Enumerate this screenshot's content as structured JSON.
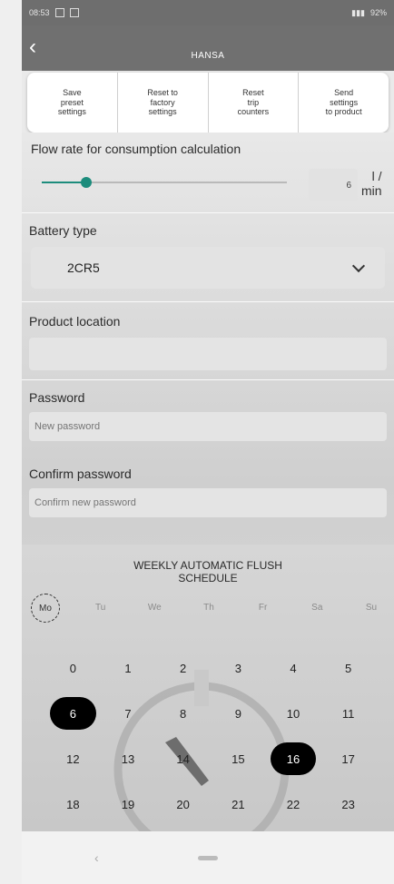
{
  "status": {
    "time": "08:53",
    "battery": "92%"
  },
  "header": {
    "title": "HANSA"
  },
  "actions": [
    {
      "label": "Save\npreset\nsettings"
    },
    {
      "label": "Reset to\nfactory\nsettings"
    },
    {
      "label": "Reset\ntrip\ncounters"
    },
    {
      "label": "Send\nsettings\nto product"
    }
  ],
  "flow": {
    "label": "Flow rate for consumption calculation",
    "value": "6",
    "unit_top": "l /",
    "unit_bottom": "min",
    "slider_fraction": 0.18
  },
  "battery": {
    "label": "Battery type",
    "value": "2CR5"
  },
  "location": {
    "label": "Product location",
    "value": ""
  },
  "password": {
    "label": "Password",
    "placeholder": "New password"
  },
  "confirm": {
    "label": "Confirm password",
    "placeholder": "Confirm new password"
  },
  "schedule": {
    "title_line1": "WEEKLY AUTOMATIC FLUSH",
    "title_line2": "SCHEDULE",
    "days": [
      "Mo",
      "Tu",
      "We",
      "Th",
      "Fr",
      "Sa",
      "Su"
    ],
    "selected_day": 0,
    "hours": [
      "0",
      "1",
      "2",
      "3",
      "4",
      "5",
      "6",
      "7",
      "8",
      "9",
      "10",
      "11",
      "12",
      "13",
      "14",
      "15",
      "16",
      "17",
      "18",
      "19",
      "20",
      "21",
      "22",
      "23"
    ],
    "selected_hours": [
      6,
      16
    ]
  },
  "colors": {
    "accent": "#1c8c7c",
    "appbar": "#707070"
  },
  "icons": {
    "back": "chevron-left-icon",
    "dropdown": "chevron-down-icon"
  }
}
